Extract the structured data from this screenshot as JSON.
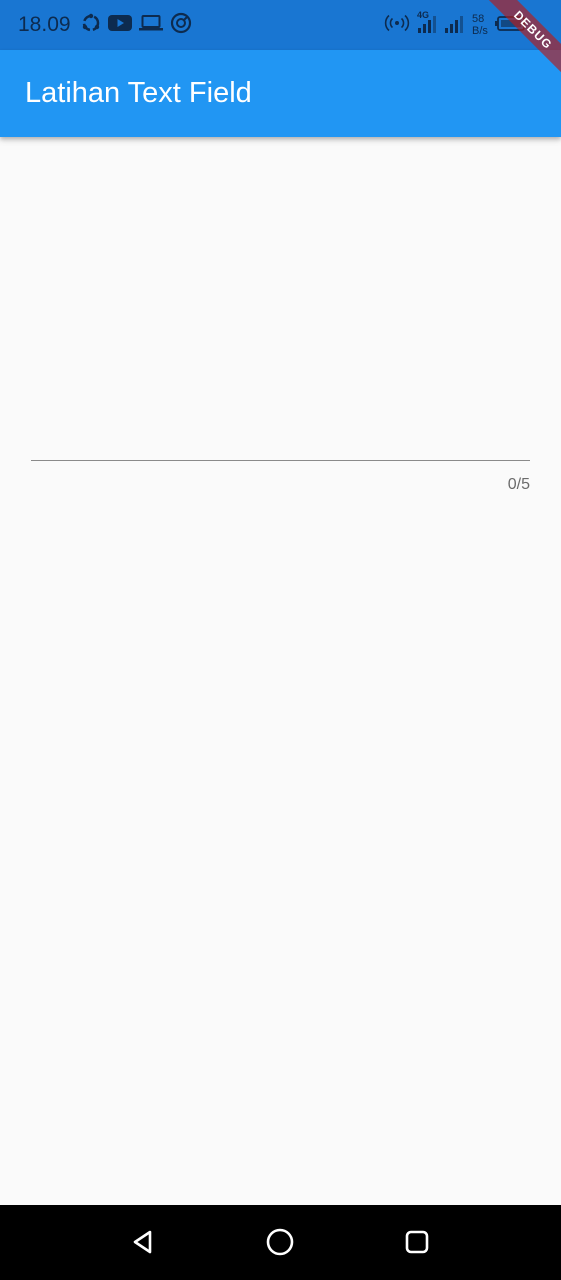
{
  "status_bar": {
    "time": "18.09",
    "left_icons": [
      "sync-icon",
      "youtube-icon",
      "laptop-icon",
      "vpn-icon"
    ],
    "right_icons": [
      "hotspot-icon",
      "signal-4g-icon",
      "signal-icon",
      "battery-icon"
    ],
    "network_type": "4G",
    "net_speed_value": "58",
    "net_speed_unit": "B/s"
  },
  "app_bar": {
    "title": "Latihan Text Field",
    "color": "#2196f3"
  },
  "debug_banner": {
    "label": "DEBUG"
  },
  "text_field": {
    "value": "",
    "counter": "0/5",
    "max_length": 5
  },
  "nav_bar": {
    "buttons": [
      "back-icon",
      "home-icon",
      "recents-icon"
    ]
  }
}
